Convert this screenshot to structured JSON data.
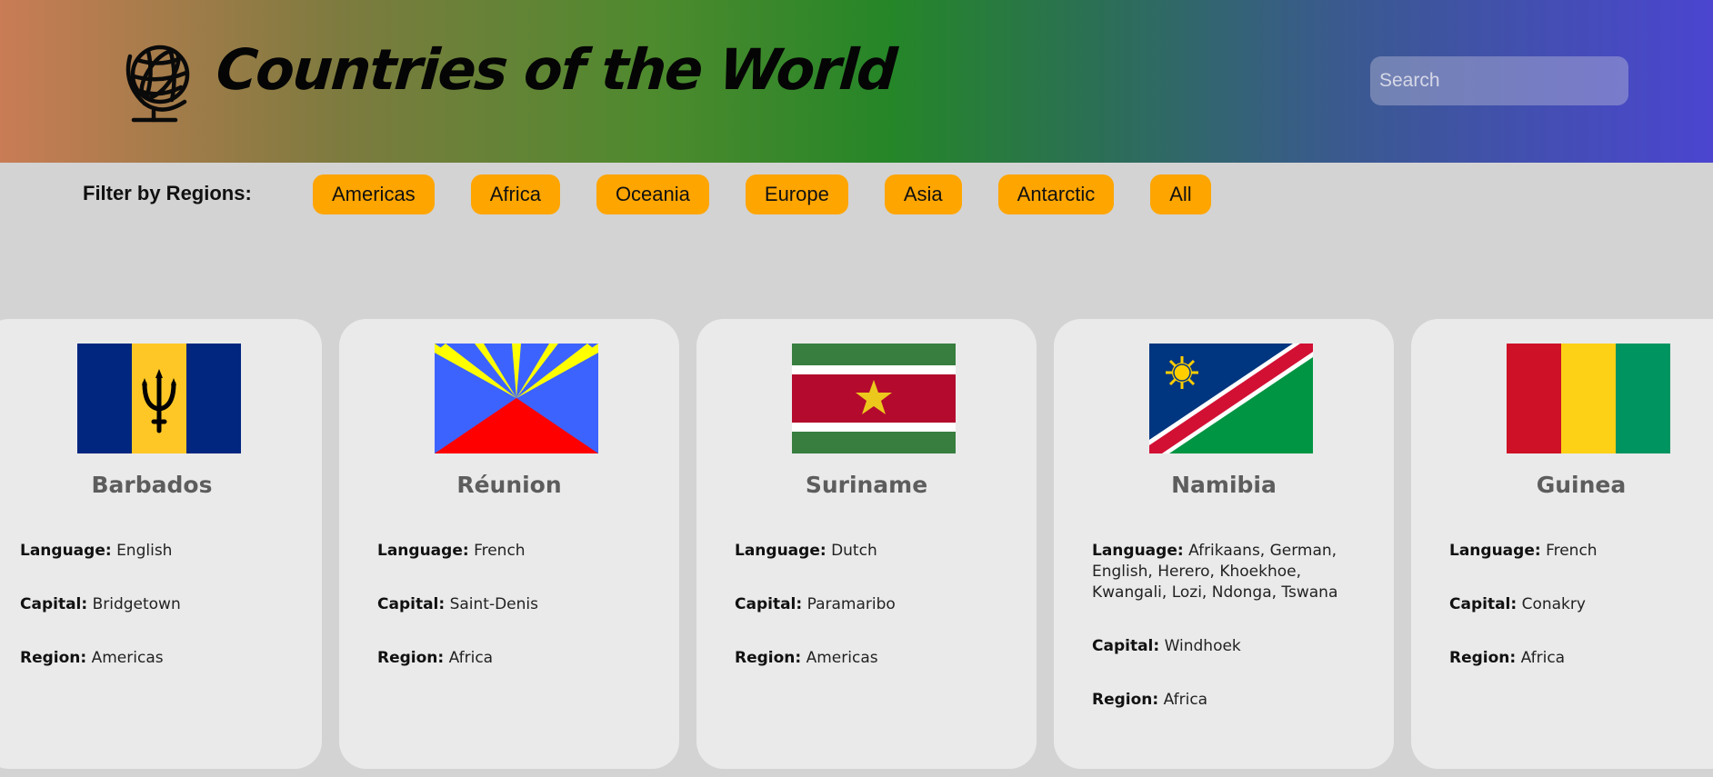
{
  "header": {
    "title": "Countries of the World",
    "logo_icon": "globe-icon",
    "search": {
      "placeholder": "Search",
      "value": ""
    }
  },
  "filters": {
    "label": "Filter by Regions:",
    "regions": [
      "Americas",
      "Africa",
      "Oceania",
      "Europe",
      "Asia",
      "Antarctic",
      "All"
    ],
    "button_color": "#ffa500"
  },
  "labels": {
    "language": "Language:",
    "capital": "Capital:",
    "region": "Region:"
  },
  "countries": [
    {
      "name": "Barbados",
      "flag_icon": "barbados-flag",
      "language": "English",
      "capital": "Bridgetown",
      "region": "Americas"
    },
    {
      "name": "Réunion",
      "flag_icon": "reunion-flag",
      "language": "French",
      "capital": "Saint-Denis",
      "region": "Africa"
    },
    {
      "name": "Suriname",
      "flag_icon": "suriname-flag",
      "language": "Dutch",
      "capital": "Paramaribo",
      "region": "Americas"
    },
    {
      "name": "Namibia",
      "flag_icon": "namibia-flag",
      "language": "Afrikaans, German, English, Herero, Khoekhoe, Kwangali, Lozi, Ndonga, Tswana",
      "capital": "Windhoek",
      "region": "Africa"
    },
    {
      "name": "Guinea",
      "flag_icon": "guinea-flag",
      "language": "French",
      "capital": "Conakry",
      "region": "Africa"
    }
  ]
}
